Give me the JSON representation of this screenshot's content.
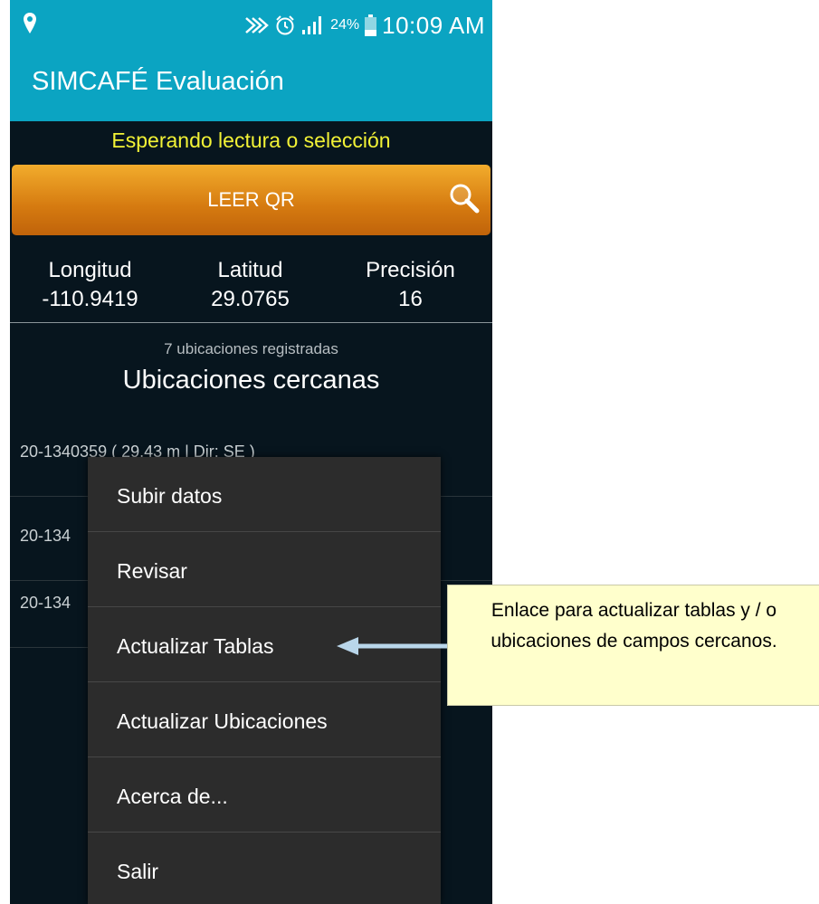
{
  "status_bar": {
    "battery_percent": "24%",
    "time": "10:09 AM",
    "icons": [
      "location-icon",
      "nfc-icon",
      "alarm-icon",
      "signal-icon",
      "battery-icon"
    ]
  },
  "app": {
    "title": "SIMCAFÉ Evaluación"
  },
  "status_message": "Esperando lectura o selección",
  "qr_button": {
    "label": "LEER QR",
    "icon": "search-icon"
  },
  "coordinates": [
    {
      "label": "Longitud",
      "value": "-110.9419"
    },
    {
      "label": "Latitud",
      "value": "29.0765"
    },
    {
      "label": "Precisión",
      "value": "16"
    }
  ],
  "locations": {
    "count_text": "7 ubicaciones registradas",
    "title": "Ubicaciones cercanas",
    "items": [
      "20-1340359 ( 29.43 m | Dir: SE )",
      "20-134",
      "20-134"
    ]
  },
  "menu": {
    "items": [
      "Subir datos",
      "Revisar",
      "Actualizar Tablas",
      "Actualizar Ubicaciones",
      "Acerca de...",
      "Salir"
    ]
  },
  "callout": {
    "text": "Enlace para actualizar tablas y / o ubicaciones de campos cercanos."
  },
  "colors": {
    "app_bar": "#0ba4c2",
    "background": "#07151e",
    "status_text": "#f2f236",
    "button_orange": "#e8901c",
    "menu_bg": "#2c2c2c",
    "callout_bg": "#ffffcc",
    "arrow": "#b9d6ea"
  }
}
